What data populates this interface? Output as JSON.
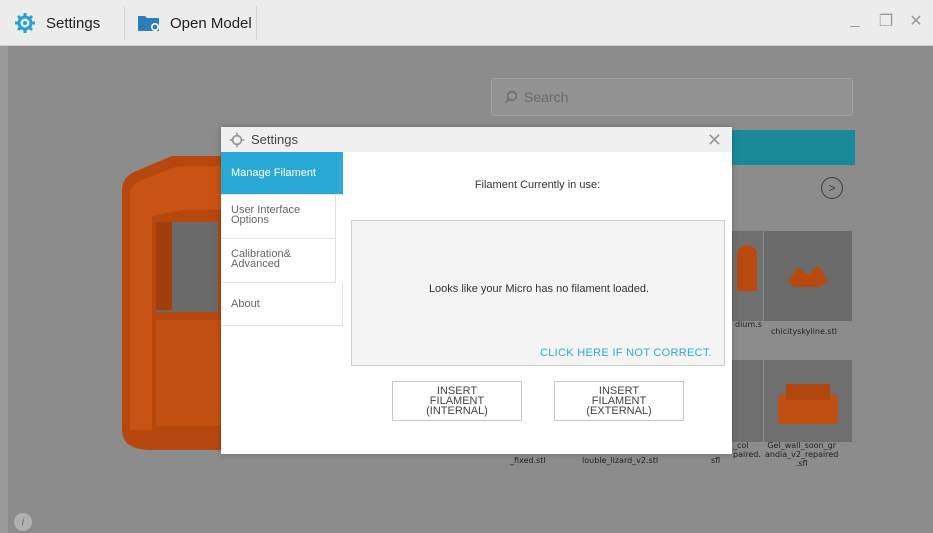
{
  "titlebar": {
    "settings_label": "Settings",
    "open_model_label": "Open Model",
    "minimize": "_",
    "restore": "❐",
    "close": "✕"
  },
  "search": {
    "placeholder": "Search"
  },
  "library": {
    "thumbnails": [
      {
        "label": "dium.s"
      },
      {
        "label": "chicityskyline.stl"
      },
      {
        "label": "_fixed.stl"
      },
      {
        "label": "louble_lizard_v2.stl"
      },
      {
        "label": "sfl"
      },
      {
        "label": "_col\npaired."
      },
      {
        "label": "Gel_wall_soon_gr\nandia_v2_repaired\n.sfl"
      }
    ]
  },
  "dialog": {
    "title": "Settings",
    "close": "✕",
    "nav": [
      {
        "label": "Manage Filament",
        "active": true
      },
      {
        "label": "User Interface Options",
        "active": false
      },
      {
        "label": "Calibration& Advanced",
        "active": false
      },
      {
        "label": "About",
        "active": false
      }
    ],
    "current_title": "Filament Currently in use:",
    "status_message": "Looks like your Micro has no filament loaded.",
    "status_link": "CLICK HERE IF NOT CORRECT.",
    "insert_internal": "INSERT FILAMENT (INTERNAL)",
    "insert_external": "INSERT FILAMENT (EXTERNAL)"
  },
  "info_icon": "i",
  "colors": {
    "accent": "#2aa9d6",
    "teal": "#1b8a98",
    "model_orange": "#c84f12"
  }
}
